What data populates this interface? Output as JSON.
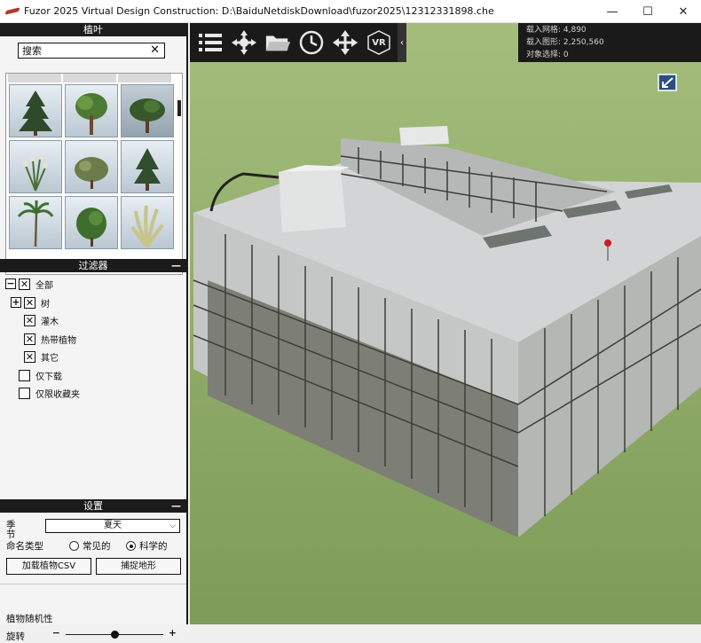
{
  "window": {
    "title": "Fuzor 2025 Virtual Design Construction: D:\\BaiduNetdiskDownload\\fuzor2025\\12312331898.che",
    "minimize": "—",
    "maximize": "☐",
    "close": "✕"
  },
  "library": {
    "header": "植叶",
    "search_value": "搜索",
    "search_clear": "✕"
  },
  "filter": {
    "header": "过滤器",
    "collapse": "—",
    "all_label": "全部",
    "tree_label": "树",
    "shrub_label": "灌木",
    "tropical_label": "热带植物",
    "other_label": "其它",
    "download_only_label": "仅下载",
    "favorites_only_label": "仅限收藏夹",
    "expand_symbol": "+",
    "collapse_symbol": "−",
    "check_symbol": "✕"
  },
  "settings": {
    "header": "设置",
    "collapse": "—",
    "season_label": "季节",
    "season_value": "夏天",
    "name_type_label": "命名类型",
    "common_label": "常见的",
    "scientific_label": "科学的",
    "load_csv_button": "加载植物CSV",
    "capture_terrain_button": "捕捉地形",
    "random_label": "植物随机性",
    "rotation_label": "旋转",
    "minus": "−",
    "plus": "+",
    "rotation_value": 0.5,
    "name_type_selected": "scientific"
  },
  "viewport": {
    "stats": {
      "loaded_meshes": "载入网格: 4,890",
      "loaded_triangles": "载入图形: 2,250,560",
      "selected_objects": "对象选择: 0"
    },
    "toolbar_icons": [
      "list-icon",
      "navigate-icon",
      "folder-icon",
      "clock-icon",
      "move-icon",
      "vr-icon"
    ],
    "vr_text": "VR",
    "collapse_arrow": "‹"
  }
}
